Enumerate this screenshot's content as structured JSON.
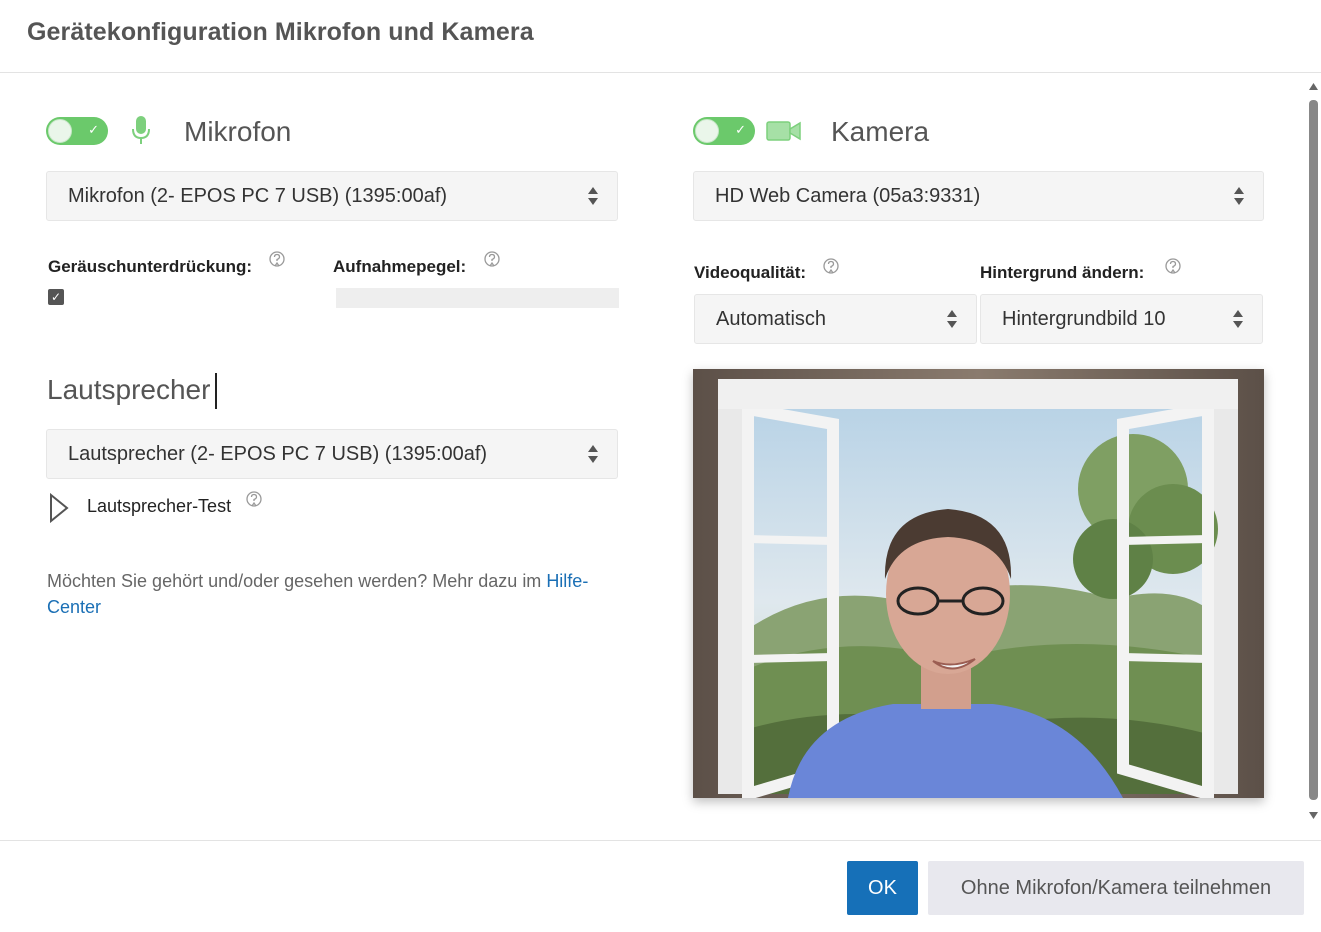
{
  "dialog": {
    "title": "Gerätekonfiguration Mikrofon und Kamera"
  },
  "microphone": {
    "enabled": true,
    "label": "Mikrofon",
    "device": "Mikrofon (2- EPOS PC 7 USB) (1395:00af)",
    "noise_suppression_label": "Geräuschunterdrückung:",
    "noise_suppression_checked": true,
    "recording_level_label": "Aufnahmepegel:",
    "recording_level": 0
  },
  "speaker": {
    "label": "Lautsprecher",
    "device": "Lautsprecher (2- EPOS PC 7 USB) (1395:00af)",
    "test_label": "Lautsprecher-Test"
  },
  "info": {
    "text": "Möchten Sie gehört und/oder gesehen werden? Mehr dazu im ",
    "link_text": "Hilfe-Center"
  },
  "camera": {
    "enabled": true,
    "label": "Kamera",
    "device": "HD Web Camera (05a3:9331)",
    "video_quality_label": "Videoqualität:",
    "video_quality_value": "Automatisch",
    "background_label": "Hintergrund ändern:",
    "background_value": "Hintergrundbild 10"
  },
  "footer": {
    "ok_label": "OK",
    "without_label": "Ohne Mikrofon/Kamera teilnehmen"
  },
  "colors": {
    "toggle_on": "#6bc96b",
    "accent": "#1670b8",
    "link": "#1a6fb5"
  }
}
